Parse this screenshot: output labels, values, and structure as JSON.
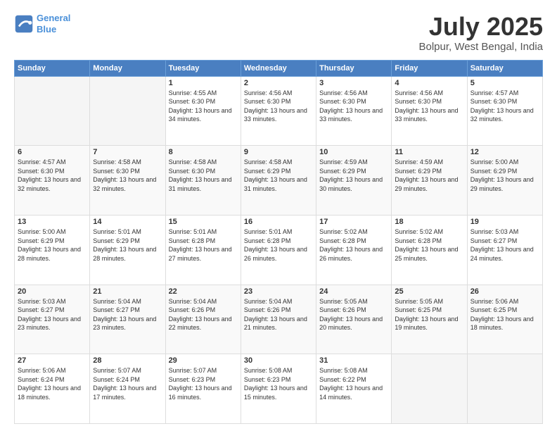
{
  "header": {
    "logo_line1": "General",
    "logo_line2": "Blue",
    "month": "July 2025",
    "location": "Bolpur, West Bengal, India"
  },
  "weekdays": [
    "Sunday",
    "Monday",
    "Tuesday",
    "Wednesday",
    "Thursday",
    "Friday",
    "Saturday"
  ],
  "weeks": [
    [
      {
        "day": "",
        "empty": true
      },
      {
        "day": "",
        "empty": true
      },
      {
        "day": "1",
        "sunrise": "Sunrise: 4:55 AM",
        "sunset": "Sunset: 6:30 PM",
        "daylight": "Daylight: 13 hours and 34 minutes."
      },
      {
        "day": "2",
        "sunrise": "Sunrise: 4:56 AM",
        "sunset": "Sunset: 6:30 PM",
        "daylight": "Daylight: 13 hours and 33 minutes."
      },
      {
        "day": "3",
        "sunrise": "Sunrise: 4:56 AM",
        "sunset": "Sunset: 6:30 PM",
        "daylight": "Daylight: 13 hours and 33 minutes."
      },
      {
        "day": "4",
        "sunrise": "Sunrise: 4:56 AM",
        "sunset": "Sunset: 6:30 PM",
        "daylight": "Daylight: 13 hours and 33 minutes."
      },
      {
        "day": "5",
        "sunrise": "Sunrise: 4:57 AM",
        "sunset": "Sunset: 6:30 PM",
        "daylight": "Daylight: 13 hours and 32 minutes."
      }
    ],
    [
      {
        "day": "6",
        "sunrise": "Sunrise: 4:57 AM",
        "sunset": "Sunset: 6:30 PM",
        "daylight": "Daylight: 13 hours and 32 minutes."
      },
      {
        "day": "7",
        "sunrise": "Sunrise: 4:58 AM",
        "sunset": "Sunset: 6:30 PM",
        "daylight": "Daylight: 13 hours and 32 minutes."
      },
      {
        "day": "8",
        "sunrise": "Sunrise: 4:58 AM",
        "sunset": "Sunset: 6:30 PM",
        "daylight": "Daylight: 13 hours and 31 minutes."
      },
      {
        "day": "9",
        "sunrise": "Sunrise: 4:58 AM",
        "sunset": "Sunset: 6:29 PM",
        "daylight": "Daylight: 13 hours and 31 minutes."
      },
      {
        "day": "10",
        "sunrise": "Sunrise: 4:59 AM",
        "sunset": "Sunset: 6:29 PM",
        "daylight": "Daylight: 13 hours and 30 minutes."
      },
      {
        "day": "11",
        "sunrise": "Sunrise: 4:59 AM",
        "sunset": "Sunset: 6:29 PM",
        "daylight": "Daylight: 13 hours and 29 minutes."
      },
      {
        "day": "12",
        "sunrise": "Sunrise: 5:00 AM",
        "sunset": "Sunset: 6:29 PM",
        "daylight": "Daylight: 13 hours and 29 minutes."
      }
    ],
    [
      {
        "day": "13",
        "sunrise": "Sunrise: 5:00 AM",
        "sunset": "Sunset: 6:29 PM",
        "daylight": "Daylight: 13 hours and 28 minutes."
      },
      {
        "day": "14",
        "sunrise": "Sunrise: 5:01 AM",
        "sunset": "Sunset: 6:29 PM",
        "daylight": "Daylight: 13 hours and 28 minutes."
      },
      {
        "day": "15",
        "sunrise": "Sunrise: 5:01 AM",
        "sunset": "Sunset: 6:28 PM",
        "daylight": "Daylight: 13 hours and 27 minutes."
      },
      {
        "day": "16",
        "sunrise": "Sunrise: 5:01 AM",
        "sunset": "Sunset: 6:28 PM",
        "daylight": "Daylight: 13 hours and 26 minutes."
      },
      {
        "day": "17",
        "sunrise": "Sunrise: 5:02 AM",
        "sunset": "Sunset: 6:28 PM",
        "daylight": "Daylight: 13 hours and 26 minutes."
      },
      {
        "day": "18",
        "sunrise": "Sunrise: 5:02 AM",
        "sunset": "Sunset: 6:28 PM",
        "daylight": "Daylight: 13 hours and 25 minutes."
      },
      {
        "day": "19",
        "sunrise": "Sunrise: 5:03 AM",
        "sunset": "Sunset: 6:27 PM",
        "daylight": "Daylight: 13 hours and 24 minutes."
      }
    ],
    [
      {
        "day": "20",
        "sunrise": "Sunrise: 5:03 AM",
        "sunset": "Sunset: 6:27 PM",
        "daylight": "Daylight: 13 hours and 23 minutes."
      },
      {
        "day": "21",
        "sunrise": "Sunrise: 5:04 AM",
        "sunset": "Sunset: 6:27 PM",
        "daylight": "Daylight: 13 hours and 23 minutes."
      },
      {
        "day": "22",
        "sunrise": "Sunrise: 5:04 AM",
        "sunset": "Sunset: 6:26 PM",
        "daylight": "Daylight: 13 hours and 22 minutes."
      },
      {
        "day": "23",
        "sunrise": "Sunrise: 5:04 AM",
        "sunset": "Sunset: 6:26 PM",
        "daylight": "Daylight: 13 hours and 21 minutes."
      },
      {
        "day": "24",
        "sunrise": "Sunrise: 5:05 AM",
        "sunset": "Sunset: 6:26 PM",
        "daylight": "Daylight: 13 hours and 20 minutes."
      },
      {
        "day": "25",
        "sunrise": "Sunrise: 5:05 AM",
        "sunset": "Sunset: 6:25 PM",
        "daylight": "Daylight: 13 hours and 19 minutes."
      },
      {
        "day": "26",
        "sunrise": "Sunrise: 5:06 AM",
        "sunset": "Sunset: 6:25 PM",
        "daylight": "Daylight: 13 hours and 18 minutes."
      }
    ],
    [
      {
        "day": "27",
        "sunrise": "Sunrise: 5:06 AM",
        "sunset": "Sunset: 6:24 PM",
        "daylight": "Daylight: 13 hours and 18 minutes."
      },
      {
        "day": "28",
        "sunrise": "Sunrise: 5:07 AM",
        "sunset": "Sunset: 6:24 PM",
        "daylight": "Daylight: 13 hours and 17 minutes."
      },
      {
        "day": "29",
        "sunrise": "Sunrise: 5:07 AM",
        "sunset": "Sunset: 6:23 PM",
        "daylight": "Daylight: 13 hours and 16 minutes."
      },
      {
        "day": "30",
        "sunrise": "Sunrise: 5:08 AM",
        "sunset": "Sunset: 6:23 PM",
        "daylight": "Daylight: 13 hours and 15 minutes."
      },
      {
        "day": "31",
        "sunrise": "Sunrise: 5:08 AM",
        "sunset": "Sunset: 6:22 PM",
        "daylight": "Daylight: 13 hours and 14 minutes."
      },
      {
        "day": "",
        "empty": true
      },
      {
        "day": "",
        "empty": true
      }
    ]
  ]
}
